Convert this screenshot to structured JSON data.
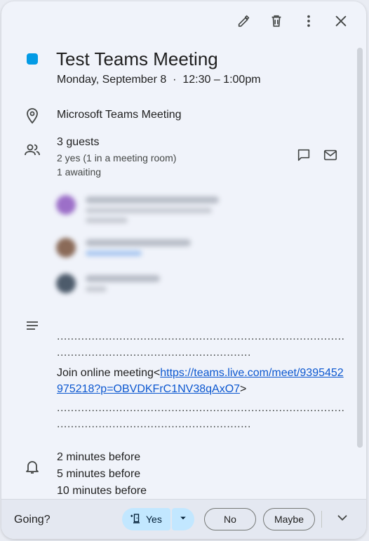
{
  "event": {
    "color": "#039be5",
    "title": "Test Teams Meeting",
    "datetime": "Monday, September 8  ·  12:30 – 1:00pm",
    "location": "Microsoft Teams Meeting"
  },
  "toolbar": {
    "edit_icon": "pencil-icon",
    "delete_icon": "trash-icon",
    "more_icon": "more-vert-icon",
    "close_icon": "close-icon"
  },
  "guests": {
    "summary": "3 guests",
    "yes_count": "2 yes (1 in a meeting room)",
    "awaiting": "1 awaiting",
    "chat_icon": "chat-icon",
    "email_icon": "email-icon"
  },
  "description": {
    "dots": "...................................................................................................................",
    "dots_short": "........................................................",
    "join_text": "Join online meeting<",
    "link": "https://teams.live.com/meet/9395452975218?p=OBVDKFrC1NV38qAxO7",
    "join_suffix": ">"
  },
  "reminders": [
    "2 minutes before",
    "5 minutes before",
    "10 minutes before"
  ],
  "rsvp": {
    "label": "Going?",
    "yes": "Yes",
    "no": "No",
    "maybe": "Maybe"
  }
}
